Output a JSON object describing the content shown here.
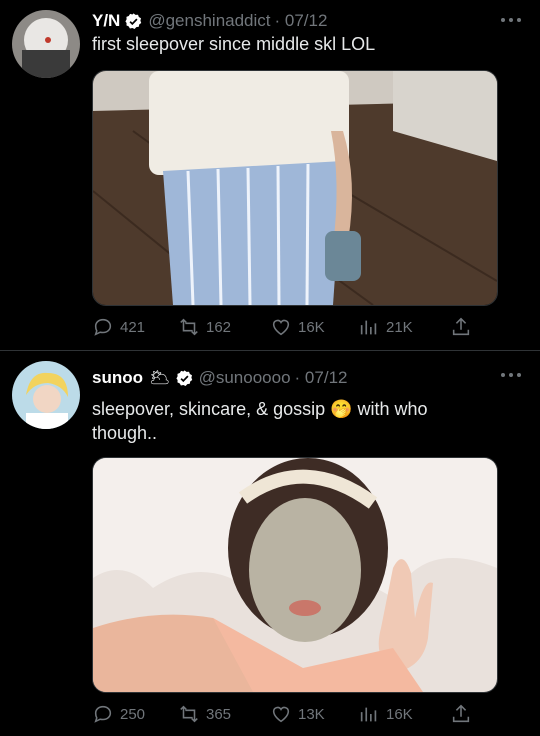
{
  "tweets": [
    {
      "name": "Y/N",
      "handle": "@genshinaddict",
      "date": "· 07/12",
      "text": "first sleepover since middle skl LOL",
      "media_alt": "photo",
      "stats": {
        "replies": "421",
        "retweets": "162",
        "likes": "16K",
        "views": "21K"
      }
    },
    {
      "name": "sunoo",
      "name_emoji": "🌥",
      "handle": "@sunooooo",
      "date": "· 07/12",
      "text": "sleepover, skincare, & gossip 🤭  with who though..",
      "media_alt": "photo",
      "stats": {
        "replies": "250",
        "retweets": "365",
        "likes": "13K",
        "views": "16K"
      }
    }
  ],
  "icons": {
    "reply": "reply-icon",
    "retweet": "retweet-icon",
    "like": "heart-icon",
    "views": "views-icon",
    "share": "share-icon",
    "verified": "verified-badge-icon",
    "more": "more-icon"
  },
  "colors": {
    "background": "#000000",
    "text": "#e7e9ea",
    "muted": "#71767b",
    "verified": "#ffffff"
  }
}
